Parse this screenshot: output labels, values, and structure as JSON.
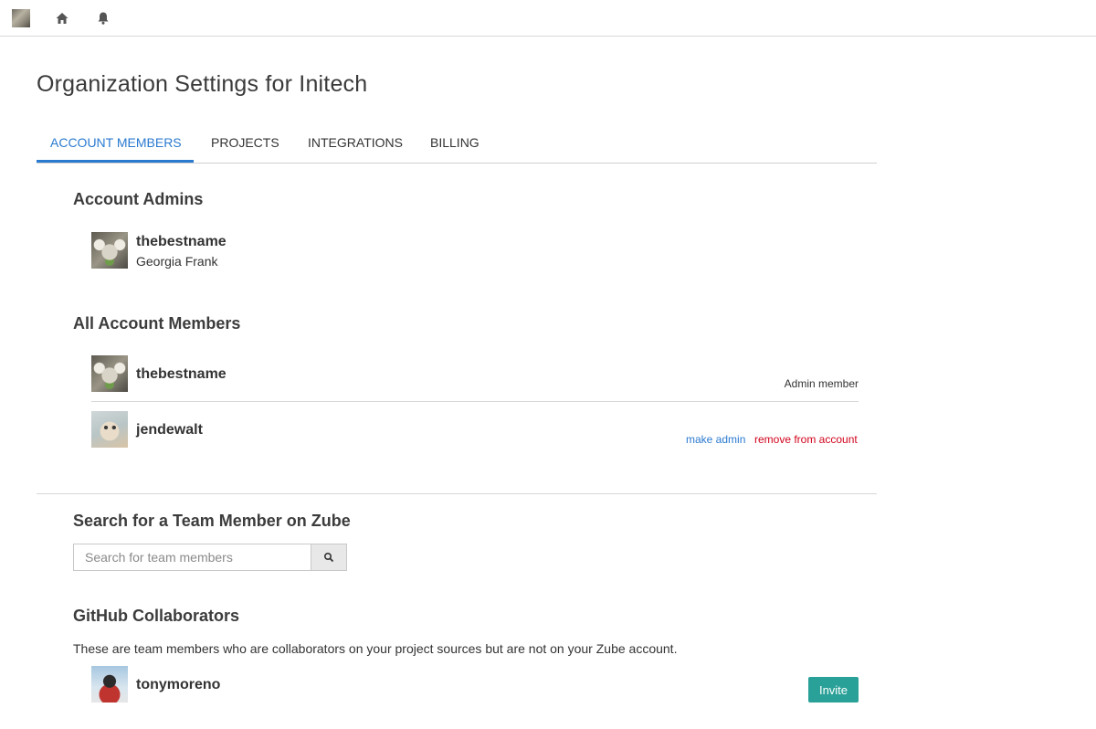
{
  "topbar": {
    "user_avatar": "koala-avatar",
    "home_icon": "home-icon",
    "bell_icon": "bell-icon"
  },
  "page": {
    "title": "Organization Settings for Initech"
  },
  "tabs": [
    {
      "label": "ACCOUNT MEMBERS",
      "active": true
    },
    {
      "label": "PROJECTS",
      "active": false
    },
    {
      "label": "INTEGRATIONS",
      "active": false
    },
    {
      "label": "BILLING",
      "active": false
    }
  ],
  "admins": {
    "heading": "Account Admins",
    "items": [
      {
        "username": "thebestname",
        "full_name": "Georgia Frank"
      }
    ]
  },
  "members": {
    "heading": "All Account Members",
    "items": [
      {
        "username": "thebestname",
        "role": "Admin member"
      },
      {
        "username": "jendewalt",
        "make_admin": "make admin",
        "remove": "remove from account"
      }
    ]
  },
  "search": {
    "heading": "Search for a Team Member on Zube",
    "placeholder": "Search for team members",
    "value": ""
  },
  "github": {
    "heading": "GitHub Collaborators",
    "description": "These are team members who are collaborators on your project sources but are not on your Zube account.",
    "items": [
      {
        "username": "tonymoreno",
        "invite_label": "Invite"
      }
    ]
  },
  "colors": {
    "accent": "#2a7ad0",
    "danger": "#d0021b",
    "invite": "#2aa198"
  }
}
